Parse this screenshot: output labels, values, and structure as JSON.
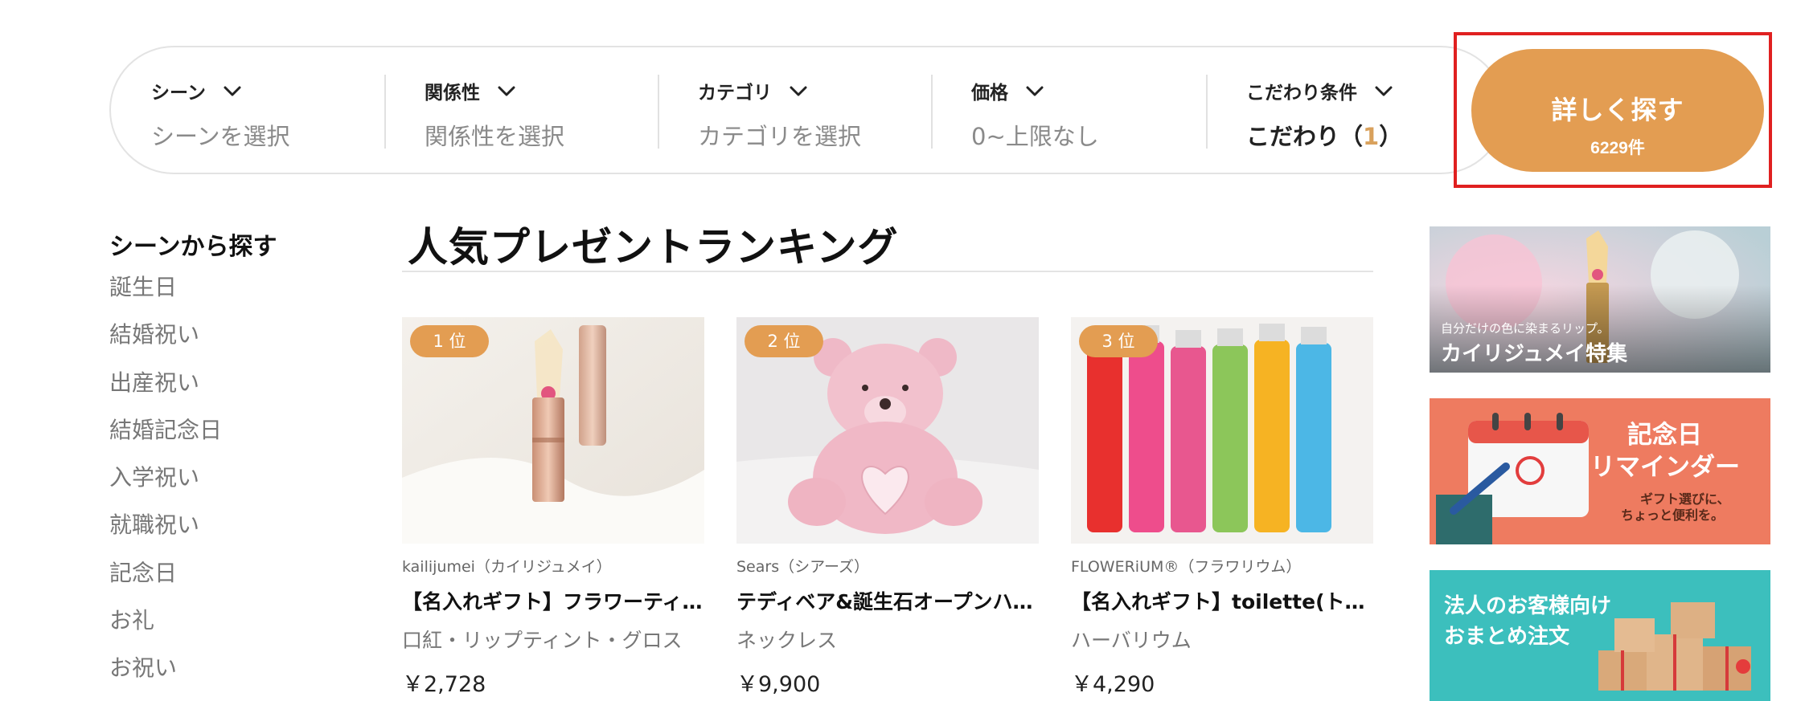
{
  "search": {
    "filters": [
      {
        "label": "シーン",
        "value": "シーンを選択"
      },
      {
        "label": "関係性",
        "value": "関係性を選択"
      },
      {
        "label": "カテゴリ",
        "value": "カテゴリを選択"
      },
      {
        "label": "価格",
        "value": "0~上限なし"
      },
      {
        "label": "こだわり条件",
        "value_prefix": "こだわり（",
        "value_count": "1",
        "value_suffix": "）"
      }
    ],
    "button_label": "詳しく探す",
    "button_count": "6229件"
  },
  "sidebar": {
    "heading": "シーンから探す",
    "items": [
      "誕生日",
      "結婚祝い",
      "出産祝い",
      "結婚記念日",
      "入学祝い",
      "就職祝い",
      "記念日",
      "お礼",
      "お祝い"
    ]
  },
  "ranking": {
    "title": "人気プレゼントランキング",
    "products": [
      {
        "rank": "1 位",
        "brand": "kailijumei（カイリジュメイ）",
        "name": "【名入れギフト】フラワーティ…",
        "category": "口紅・リップティント・グロス",
        "price": "￥2,728"
      },
      {
        "rank": "2 位",
        "brand": "Sears（シアーズ）",
        "name": "テディベア&誕生石オープンハ…",
        "category": "ネックレス",
        "price": "￥9,900"
      },
      {
        "rank": "3 位",
        "brand": "FLOWERiUM®（フラワリウム）",
        "name": "【名入れギフト】toilette(トワレ)",
        "category": "ハーバリウム",
        "price": "￥4,290"
      }
    ]
  },
  "banners": [
    {
      "caption": "自分だけの色に染まるリップ。",
      "title": "カイリジュメイ特集"
    },
    {
      "title_line1": "記念日",
      "title_line2": "リマインダー",
      "sub_line1": "ギフト選びに、",
      "sub_line2": "ちょっと便利を。"
    },
    {
      "title_line1": "法人のお客様向け",
      "title_line2": "おまとめ注文"
    }
  ],
  "colors": {
    "accent": "#e39d52",
    "highlight_frame": "#e02020",
    "banner_reminder": "#ee7b60",
    "banner_corporate": "#3cbfbd"
  }
}
